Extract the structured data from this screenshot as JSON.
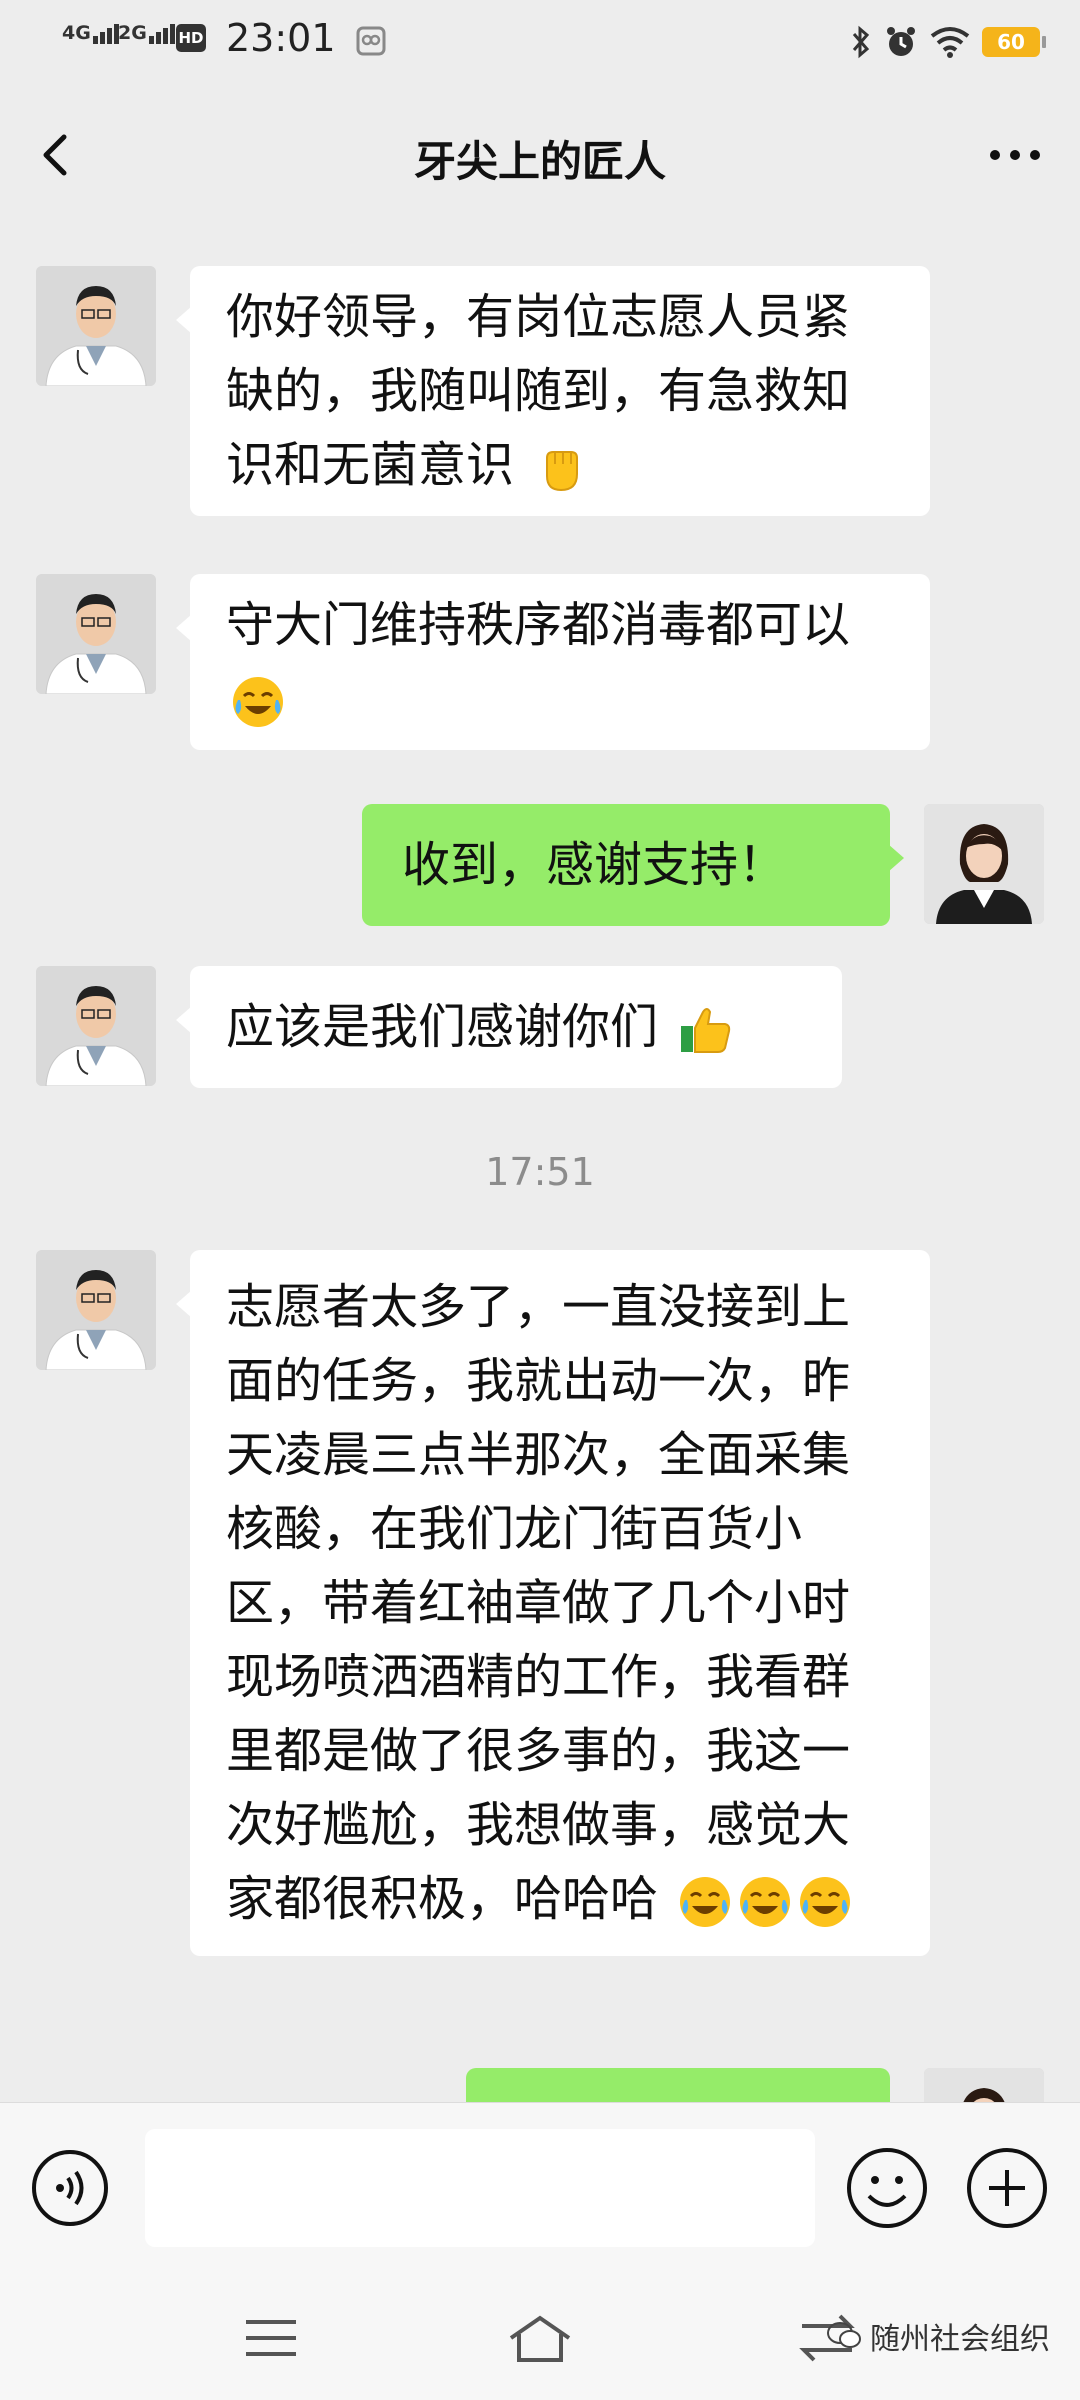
{
  "status_bar": {
    "sim1": "4G",
    "sim2": "2G",
    "hd": "HD",
    "time": "23:01",
    "battery": "60"
  },
  "header": {
    "title": "牙尖上的匠人"
  },
  "messages": [
    {
      "side": "left",
      "text": "你好领导，有岗位志愿人员紧缺的，我随叫随到，有急救知识和无菌意识",
      "emoji": "raised-fist-icon"
    },
    {
      "side": "left",
      "text": "守大门维持秩序都消毒都可以",
      "emoji": "laughing-tears-icon"
    },
    {
      "side": "right",
      "text": "收到，感谢支持！"
    },
    {
      "side": "left",
      "text": "应该是我们感谢你们",
      "emoji": "thumbs-up-icon"
    },
    {
      "side": "left",
      "text": "志愿者太多了，一直没接到上面的任务，我就出动一次，昨天凌晨三点半那次，全面采集核酸，在我们龙门街百货小区，带着红袖章做了几个小时现场喷洒酒精的工作，我看群里都是做了很多事的，我这一次好尴尬，我想做事，感觉大家都很积极，哈哈哈",
      "emoji": "laughing-tears-icon x3"
    }
  ],
  "timestamp": "17:51",
  "input": {
    "placeholder": ""
  },
  "watermark": "随州社会组织",
  "colors": {
    "background": "#ededed",
    "bubble_self": "#95ec69",
    "bubble_other": "#ffffff",
    "battery": "#f5b41a"
  }
}
